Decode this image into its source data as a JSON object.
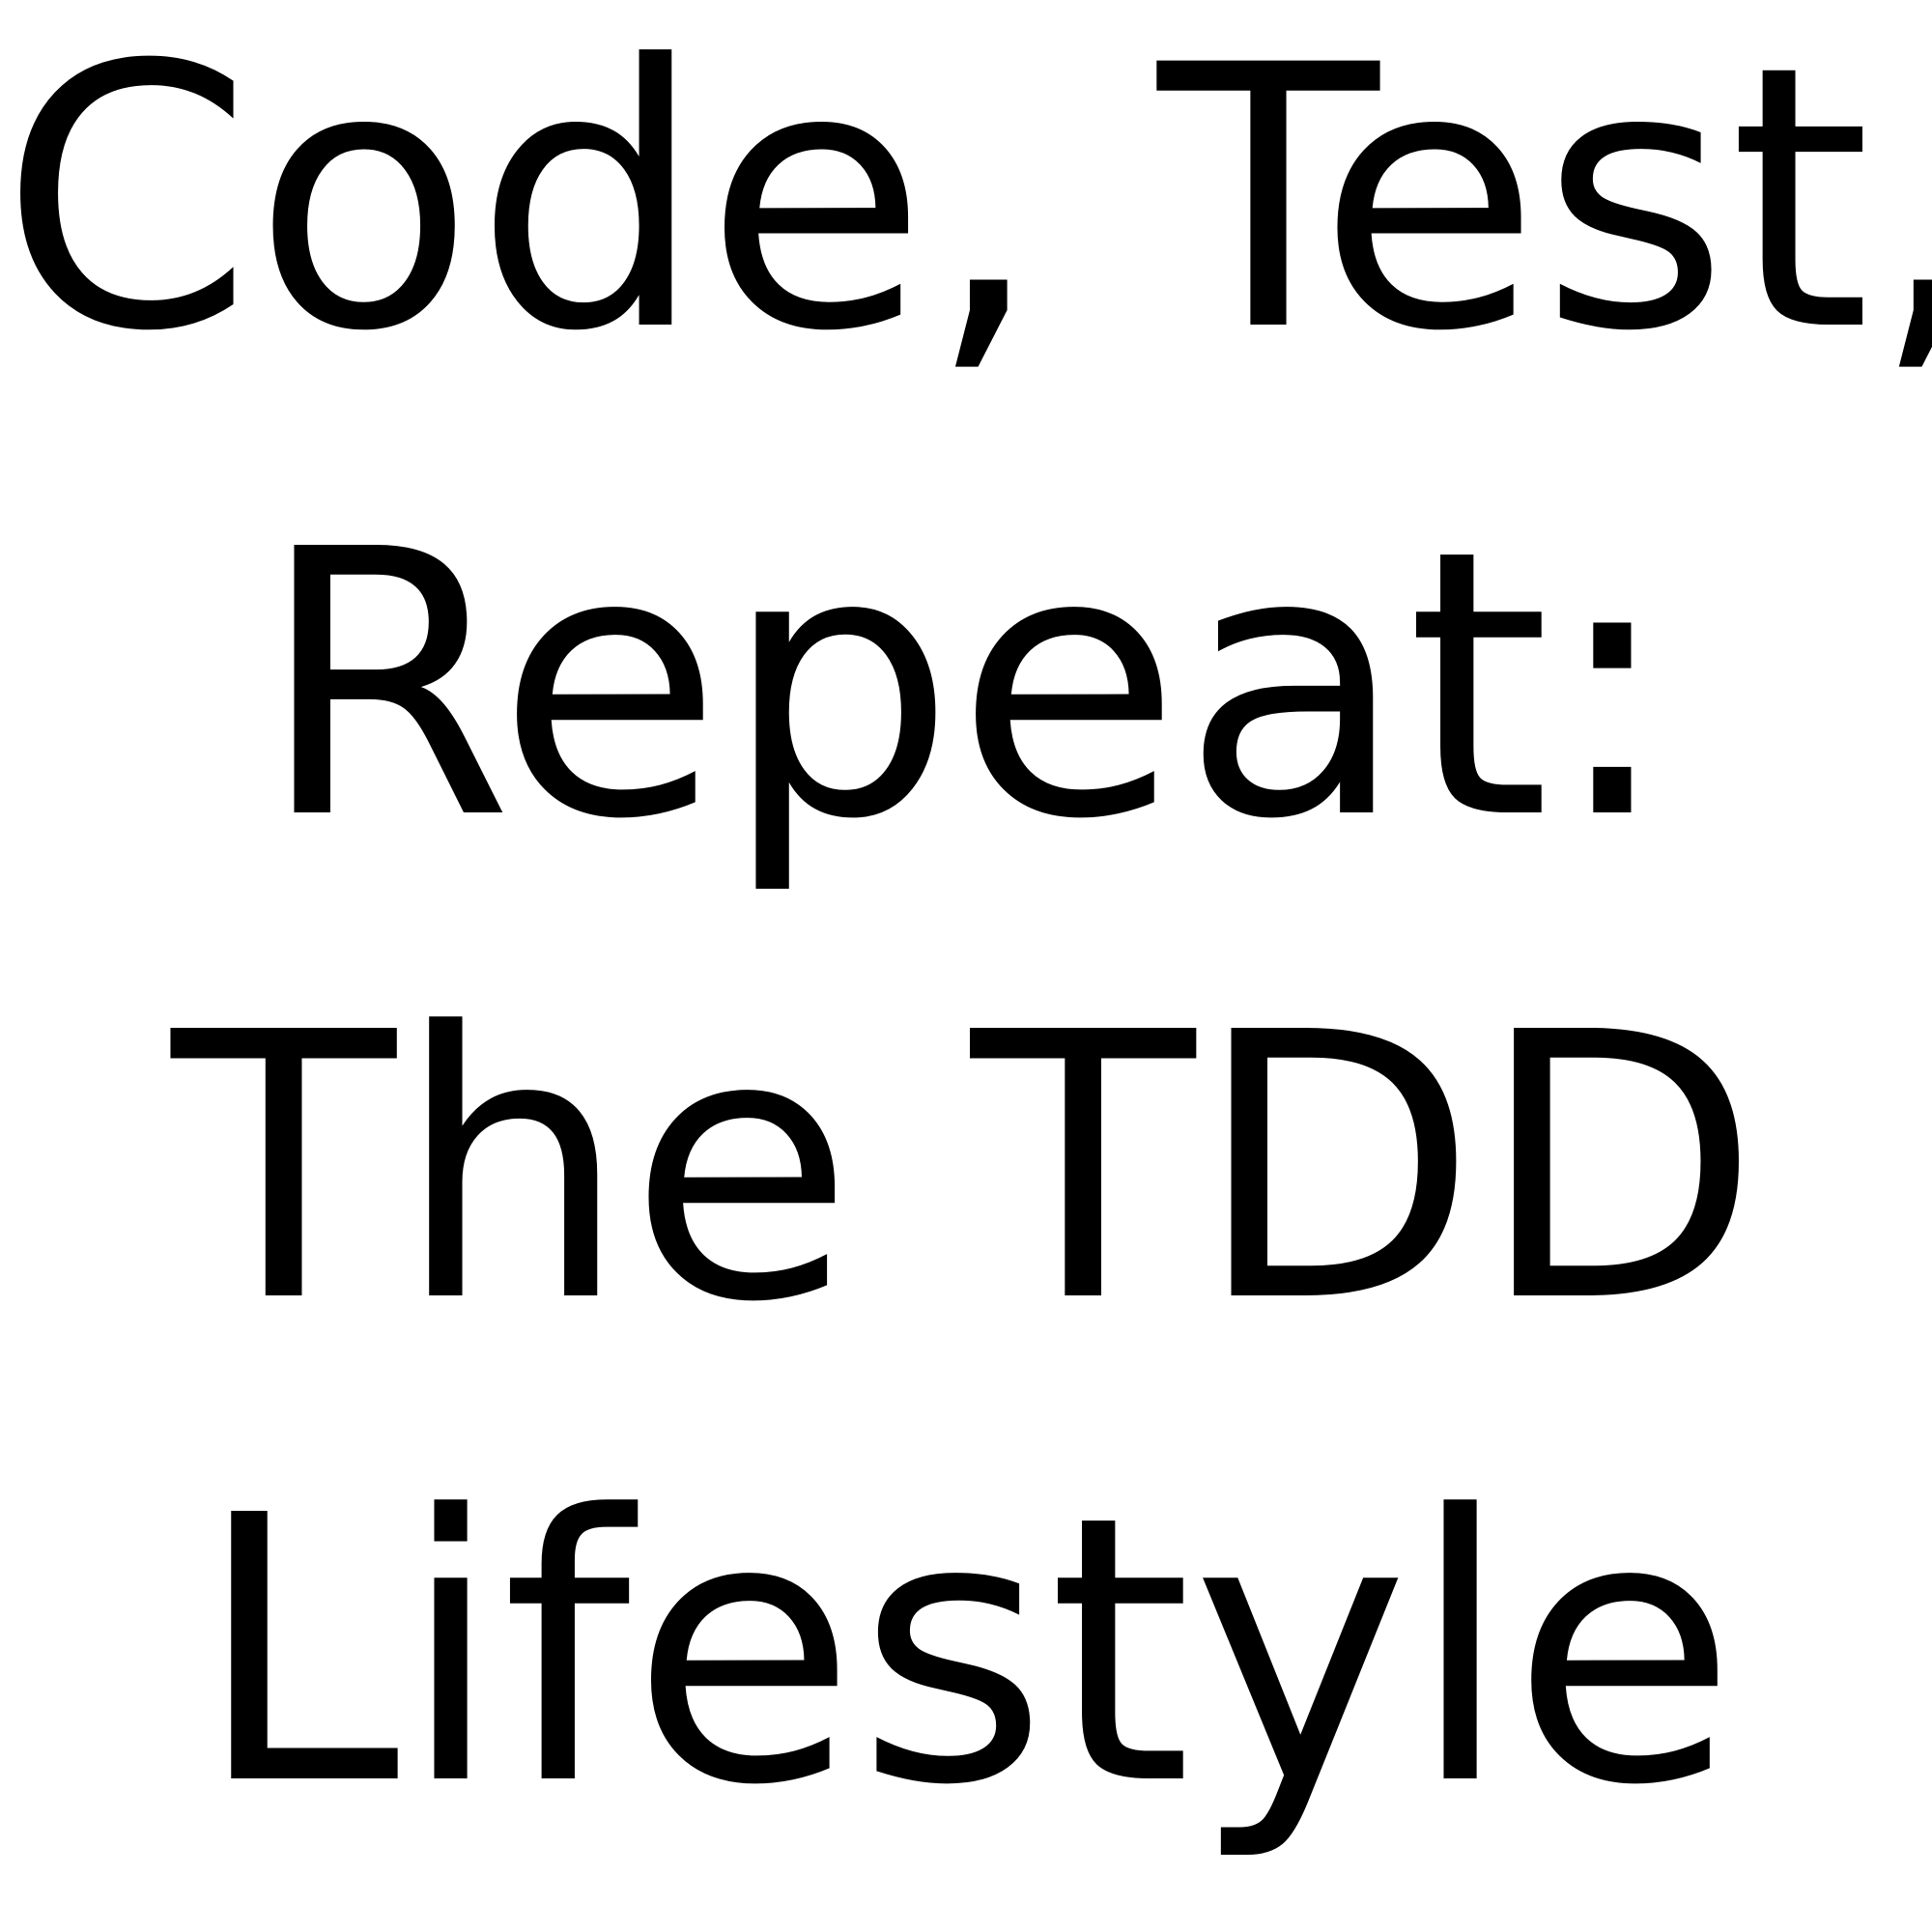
{
  "lines": [
    "Code, Test,",
    "Repeat:",
    "The TDD",
    "Lifestyle"
  ],
  "colors": {
    "text": "#000000",
    "background": "#ffffff"
  }
}
